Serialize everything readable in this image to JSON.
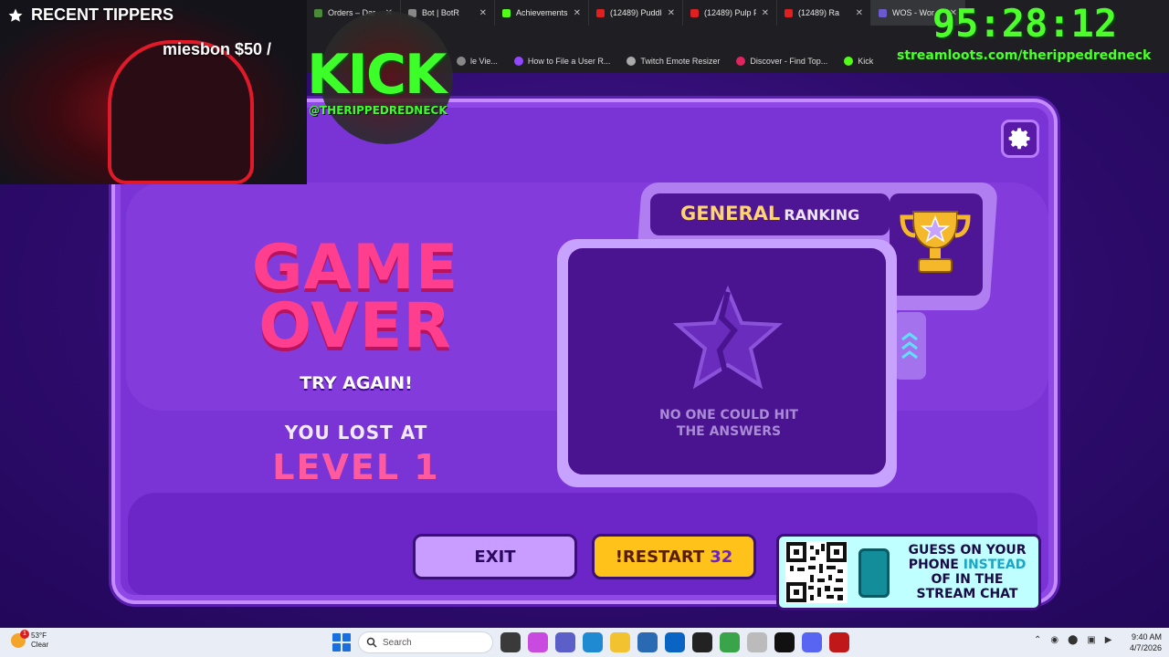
{
  "browser": {
    "tabs": [
      {
        "label": "Orders – Dar",
        "color": "#4a8a3a"
      },
      {
        "label": "Bot | BotR",
        "color": "#888888"
      },
      {
        "label": "Achievements",
        "color": "#53fc18"
      },
      {
        "label": "(12489) Puddle",
        "color": "#e02020"
      },
      {
        "label": "(12489) Pulp Fi",
        "color": "#e02020"
      },
      {
        "label": "(12489) Ra",
        "color": "#e02020"
      },
      {
        "label": "WOS - Wor",
        "color": "#6a5acd"
      }
    ],
    "bookmarks": [
      {
        "label": "le Vie..."
      },
      {
        "label": "How to File a User R..."
      },
      {
        "label": "Twitch Emote Resizer"
      },
      {
        "label": "Discover - Find Top..."
      },
      {
        "label": "Kick"
      }
    ]
  },
  "overlay": {
    "tippers_title": "RECENT TIPPERS",
    "tipper_entry": "miesbon $50 /",
    "kick_word": "KICK",
    "kick_handle": "@THERIPPEDREDNECK",
    "timer": "95:28:12",
    "streamloots": "streamloots.com/therippedredneck"
  },
  "game": {
    "title_line1": "GAME",
    "title_line2": "OVER",
    "try_again": "TRY AGAIN!",
    "lost_at": "YOU LOST AT",
    "level": "LEVEL 1",
    "ranking_title": "GENERAL",
    "ranking_sub": "RANKING",
    "empty_line1": "NO ONE COULD HIT",
    "empty_line2": "THE ANSWERS",
    "exit_label": "EXIT",
    "restart_label": "!RESTART",
    "restart_count": "32",
    "qr_text_1": "GUESS ON YOUR",
    "qr_text_2": "PHONE",
    "qr_text_3": "INSTEAD",
    "qr_text_4": "OF IN THE",
    "qr_text_5": "STREAM CHAT"
  },
  "taskbar": {
    "temp": "53°F",
    "condition": "Clear",
    "weather_badge": "1",
    "search_placeholder": "Search",
    "time": "9:40 AM",
    "date": "4/7/2026"
  }
}
